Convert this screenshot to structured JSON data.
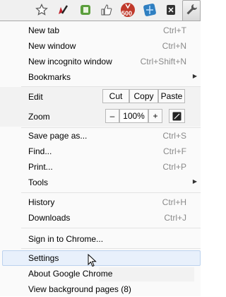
{
  "toolbar": {
    "icons": [
      "star-icon",
      "pen-extension-icon",
      "evernote-icon",
      "thumbs-up-icon",
      "badge-extension-icon",
      "globe-extension-icon",
      "cut-extension-icon",
      "wrench-icon"
    ],
    "badge_text": "500"
  },
  "menu": {
    "new_tab": {
      "label": "New tab",
      "shortcut": "Ctrl+T"
    },
    "new_window": {
      "label": "New window",
      "shortcut": "Ctrl+N"
    },
    "new_incognito": {
      "label": "New incognito window",
      "shortcut": "Ctrl+Shift+N"
    },
    "bookmarks": {
      "label": "Bookmarks"
    },
    "edit": {
      "label": "Edit",
      "cut": "Cut",
      "copy": "Copy",
      "paste": "Paste"
    },
    "zoom": {
      "label": "Zoom",
      "minus": "–",
      "level": "100%",
      "plus": "+"
    },
    "save_page": {
      "label": "Save page as...",
      "shortcut": "Ctrl+S"
    },
    "find": {
      "label": "Find...",
      "shortcut": "Ctrl+F"
    },
    "print": {
      "label": "Print...",
      "shortcut": "Ctrl+P"
    },
    "tools": {
      "label": "Tools"
    },
    "history": {
      "label": "History",
      "shortcut": "Ctrl+H"
    },
    "downloads": {
      "label": "Downloads",
      "shortcut": "Ctrl+J"
    },
    "sign_in": {
      "label": "Sign in to Chrome..."
    },
    "settings": {
      "label": "Settings"
    },
    "about": {
      "label": "About Google Chrome"
    },
    "background_pages": {
      "label": "View background pages (8)"
    }
  },
  "colors": {
    "highlight": "#e8f0fb",
    "badge_red": "#c0392b"
  }
}
